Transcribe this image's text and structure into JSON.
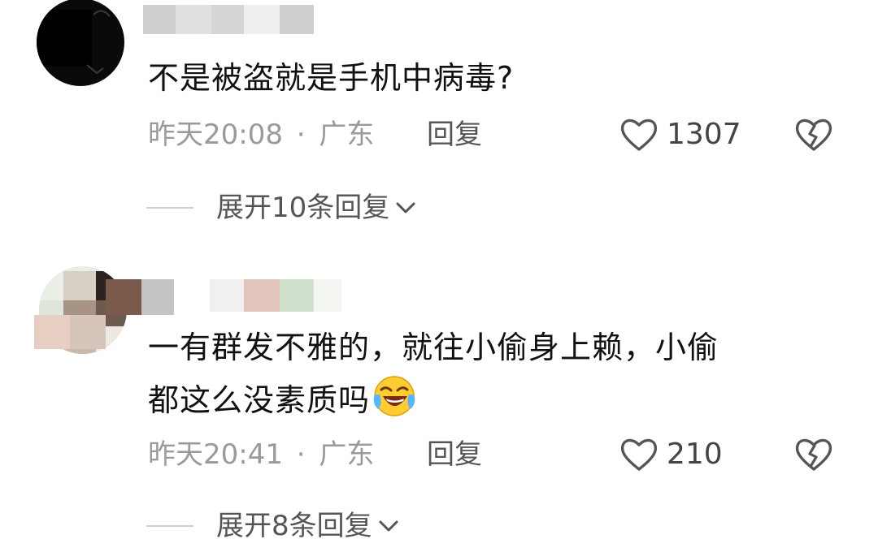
{
  "comments": [
    {
      "username": "",
      "text": "不是被盗就是手机中病毒?",
      "time": "昨天20:08",
      "separator": "·",
      "location": "广东",
      "reply_label": "回复",
      "like_count": "1307",
      "expand_label": "展开10条回复"
    },
    {
      "username": "",
      "text_line1": "一有群发不雅的，就往小偷身上赖，小偷",
      "text_line2": "都这么没素质吗",
      "emoji": "laughing-crying-emoji",
      "time": "昨天20:41",
      "separator": "·",
      "location": "广东",
      "reply_label": "回复",
      "like_count": "210",
      "expand_label": "展开8条回复"
    }
  ],
  "icons": {
    "like": "heart-outline-icon",
    "dislike": "broken-heart-icon",
    "expand": "chevron-down-icon"
  },
  "colors": {
    "text": "#111111",
    "meta": "#9a9a9a",
    "action": "#555555",
    "divider": "#d0d0d0"
  }
}
